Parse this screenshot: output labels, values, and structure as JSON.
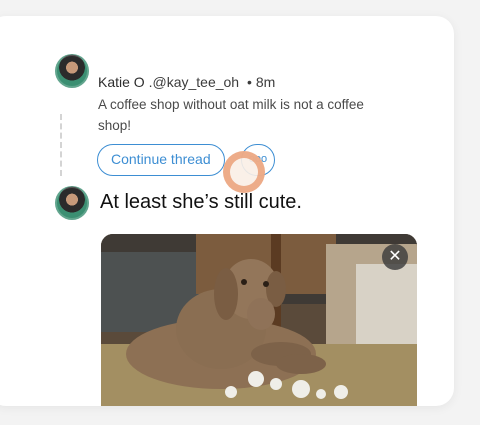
{
  "parent_tweet": {
    "author_name": "Katie O",
    "author_handle": ".@kay_tee_oh",
    "separator": "•",
    "timestamp": "8m",
    "text": "A coffee shop without oat milk is not a coffee shop!"
  },
  "actions": {
    "continue_label": "Continue thread",
    "more_label": "ooo"
  },
  "reply": {
    "text": "At least she’s still cute."
  },
  "media": {
    "close_glyph": "✕",
    "icon": "close-icon"
  },
  "colors": {
    "accent": "#3d8ed3",
    "touch_indicator": "#e89669"
  }
}
